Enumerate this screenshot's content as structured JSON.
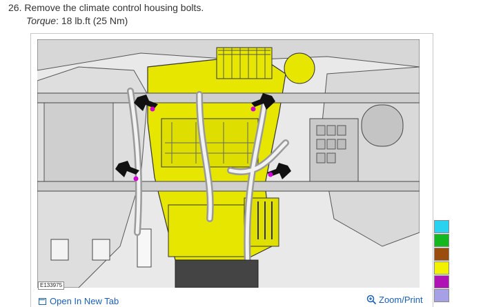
{
  "step": {
    "number": "26.",
    "text": "Remove the climate control housing bolts."
  },
  "torque": {
    "label": "Torque",
    "value": ": 18 lb.ft (25 Nm)"
  },
  "figure": {
    "id_label": "E133975"
  },
  "actions": {
    "open_tab_label": "Open In New Tab",
    "zoom_print_label": "Zoom/Print",
    "open_tab_icon": "open-tab-icon",
    "zoom_icon": "zoom-in-icon"
  },
  "swatches": [
    {
      "name": "swatch-cyan",
      "color": "#29d3f0"
    },
    {
      "name": "swatch-green",
      "color": "#12b81e"
    },
    {
      "name": "swatch-brown",
      "color": "#9b4d0e"
    },
    {
      "name": "swatch-yellow",
      "color": "#f2f200"
    },
    {
      "name": "swatch-magenta",
      "color": "#b012b5"
    },
    {
      "name": "swatch-lavender",
      "color": "#a6a0e6"
    }
  ],
  "colors": {
    "link": "#1a5fb4",
    "housing": "#e6e600",
    "bolt_marker": "#d000d0"
  }
}
